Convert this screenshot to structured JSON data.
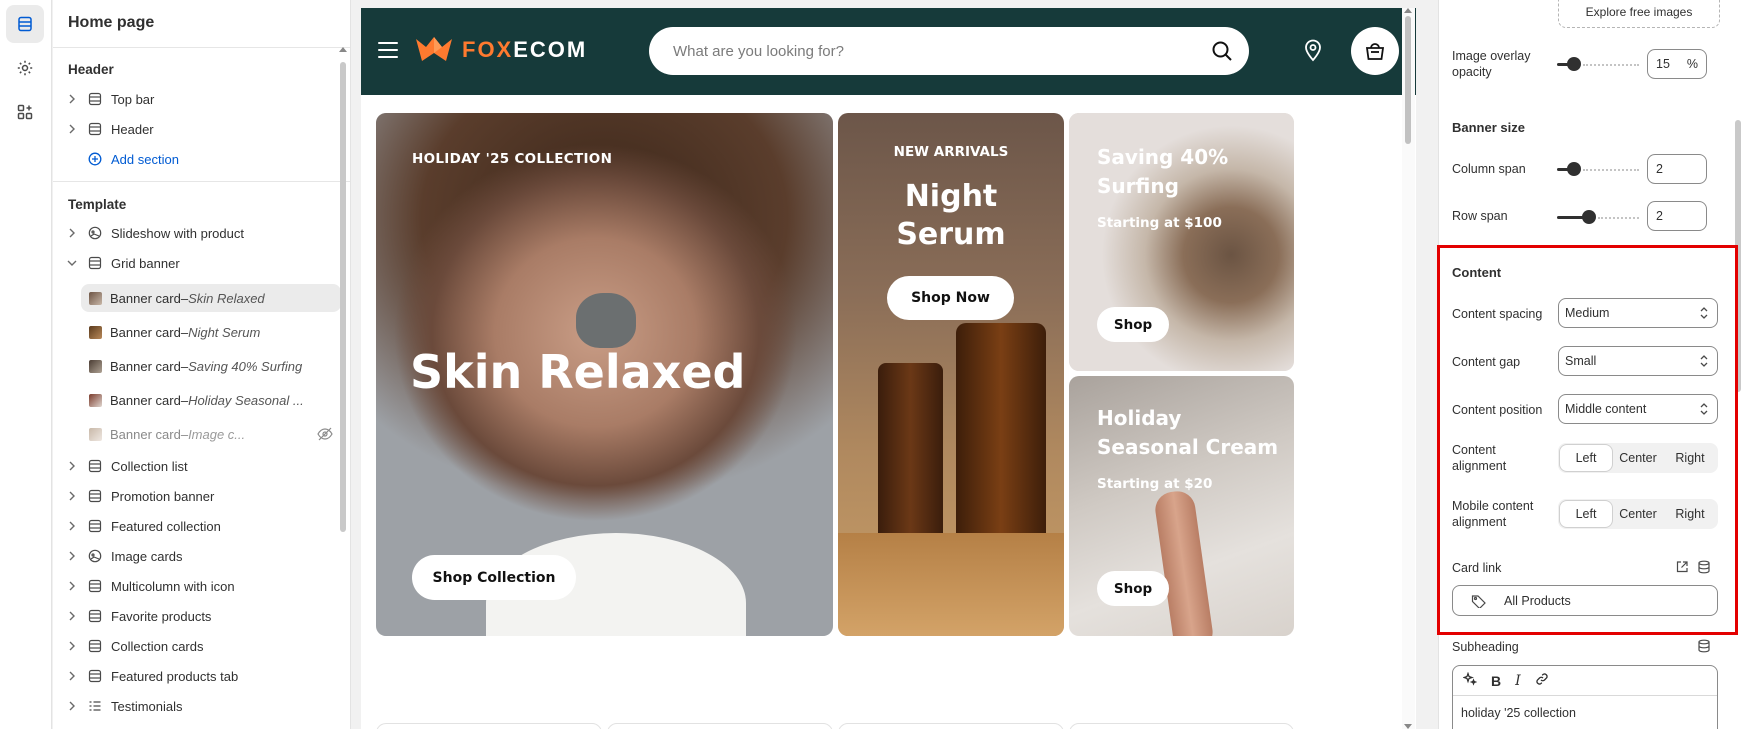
{
  "sidebar": {
    "title": "Home page",
    "header_group": "Header",
    "header_items": [
      {
        "label": "Top bar"
      },
      {
        "label": "Header"
      }
    ],
    "add_section_label": "Add section",
    "template_group": "Template",
    "template_items": [
      {
        "label": "Slideshow with product"
      },
      {
        "label": "Grid banner"
      }
    ],
    "grid_children": [
      {
        "prefix": "Banner card",
        "dash": " – ",
        "name": "Skin Relaxed"
      },
      {
        "prefix": "Banner card",
        "dash": " – ",
        "name": "Night Serum"
      },
      {
        "prefix": "Banner card",
        "dash": " – ",
        "name": "Saving 40% Surfing"
      },
      {
        "prefix": "Banner card",
        "dash": " – ",
        "name": "Holiday Seasonal ..."
      },
      {
        "prefix": "Banner card",
        "dash": " – ",
        "name": "Image c..."
      }
    ],
    "more_items": [
      {
        "label": "Collection list"
      },
      {
        "label": "Promotion banner"
      },
      {
        "label": "Featured collection"
      },
      {
        "label": "Image cards"
      },
      {
        "label": "Multicolumn with icon"
      },
      {
        "label": "Favorite products"
      },
      {
        "label": "Collection cards"
      },
      {
        "label": "Featured products tab"
      },
      {
        "label": "Testimonials"
      }
    ]
  },
  "store": {
    "logo": {
      "part1": "FOX",
      "part2": "ECOM"
    },
    "search_placeholder": "What are you looking for?",
    "cards": {
      "skin": {
        "eyebrow": "HOLIDAY '25 COLLECTION",
        "title": "Skin Relaxed",
        "button": "Shop Collection"
      },
      "serum": {
        "eyebrow": "NEW ARRIVALS",
        "title_line1": "Night",
        "title_line2": "Serum",
        "button": "Shop Now"
      },
      "surf": {
        "title_line1": "Saving 40%",
        "title_line2": "Surfing",
        "sub": "Starting at $100",
        "button": "Shop"
      },
      "holiday": {
        "title_line1": "Holiday",
        "title_line2": "Seasonal Cream",
        "sub": "Starting at $20",
        "button": "Shop"
      }
    }
  },
  "settings": {
    "explore_label": "Explore free images",
    "overlay_label_1": "Image overlay",
    "overlay_label_2": "opacity",
    "overlay_value": "15",
    "overlay_unit": "%",
    "overlay_level": 0.15,
    "banner_size_heading": "Banner size",
    "column_span_label": "Column span",
    "column_span_value": "2",
    "row_span_label": "Row span",
    "row_span_value": "2",
    "content_heading": "Content",
    "content_spacing_label": "Content spacing",
    "content_spacing_value": "Medium",
    "content_gap_label": "Content gap",
    "content_gap_value": "Small",
    "content_position_label": "Content position",
    "content_position_value": "Middle content",
    "content_alignment_label_1": "Content",
    "content_alignment_label_2": "alignment",
    "mobile_alignment_label_1": "Mobile content",
    "mobile_alignment_label_2": "alignment",
    "alignment_options": [
      "Left",
      "Center",
      "Right"
    ],
    "content_alignment_selected": "Left",
    "mobile_alignment_selected": "Left",
    "card_link_label": "Card link",
    "card_link_value": "All Products",
    "subheading_label": "Subheading",
    "subheading_text": "holiday '25 collection"
  },
  "colors": {
    "header_bg": "#163a3a",
    "brand_orange": "#ff7a2f",
    "highlight": "#e30000",
    "link_blue": "#005bd3"
  }
}
